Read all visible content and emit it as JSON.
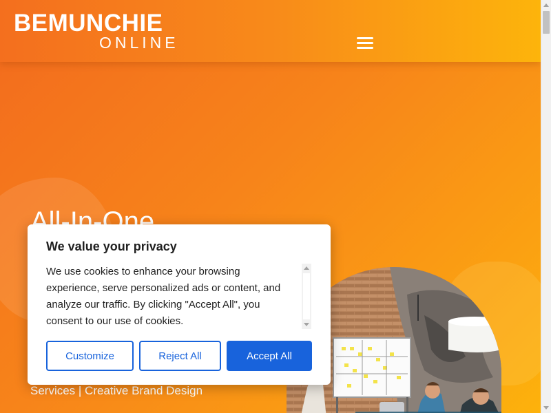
{
  "header": {
    "logo_top": "BEMUNCHIE",
    "logo_bottom": "ONLINE",
    "menu_icon": "hamburger-menu-icon"
  },
  "hero": {
    "title": "All-In-One",
    "subtitle": "Services | Creative Brand Design",
    "image": "team-meeting-whiteboard-photo"
  },
  "cookie_consent": {
    "title": "We value your privacy",
    "body": "We use cookies to enhance your browsing experience, serve personalized ads or content, and analyze our traffic. By clicking \"Accept All\", you consent to our use of cookies.",
    "buttons": {
      "customize": "Customize",
      "reject": "Reject All",
      "accept": "Accept All"
    }
  },
  "colors": {
    "brand_orange": "#f7841a",
    "brand_yellow": "#fdb20c",
    "button_blue": "#1863dc",
    "text_dark": "#212121"
  }
}
